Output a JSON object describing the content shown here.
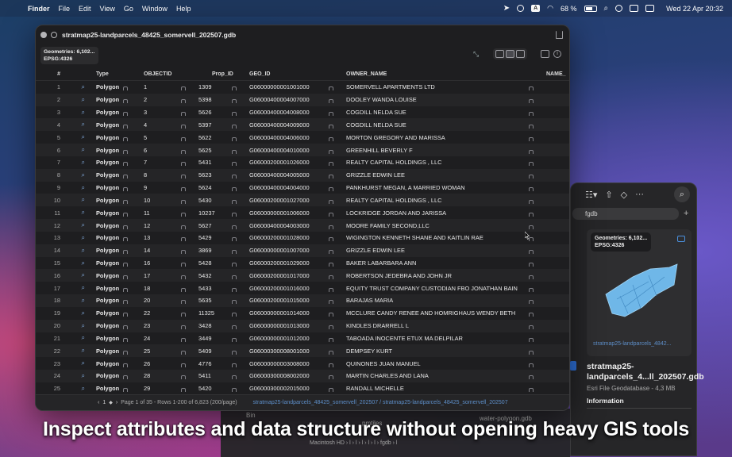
{
  "menubar": {
    "app": "Finder",
    "items": [
      "File",
      "Edit",
      "View",
      "Go",
      "Window",
      "Help"
    ],
    "battery": "68 %",
    "clock": "Wed 22 Apr  20:32",
    "icons": [
      "apple-icon",
      "telegram-icon",
      "shield-icon",
      "input-a-icon",
      "wifi-icon",
      "battery-icon",
      "search-icon",
      "user-circle-icon",
      "window-icon",
      "control-center-icon"
    ]
  },
  "window": {
    "title": "stratmap25-landparcels_48425_somervell_202507.gdb",
    "badge_line1": "Geometries: 6,102...",
    "badge_line2": "EPSG:4326"
  },
  "table": {
    "columns": [
      "#",
      "",
      "Type",
      "OBJECTID",
      "Prop_ID",
      "GEO_ID",
      "OWNER_NAME",
      "NAME_"
    ],
    "rows": [
      [
        "1",
        "Polygon",
        "1",
        "1309",
        "G06000000001001000",
        "SOMERVELL APARTMENTS LTD"
      ],
      [
        "2",
        "Polygon",
        "2",
        "5398",
        "G06000400004007000",
        "DOOLEY WANDA LOUISE"
      ],
      [
        "3",
        "Polygon",
        "3",
        "5626",
        "G06000400004008000",
        "COGDILL NELDA SUE"
      ],
      [
        "4",
        "Polygon",
        "4",
        "5397",
        "G06000400004009000",
        "COGDILL NELDA SUE"
      ],
      [
        "5",
        "Polygon",
        "5",
        "5622",
        "G06000400004006000",
        "MORTON GREGORY AND MARISSA"
      ],
      [
        "6",
        "Polygon",
        "6",
        "5625",
        "G06000400004010000",
        "GREENHILL BEVERLY F"
      ],
      [
        "7",
        "Polygon",
        "7",
        "5431",
        "G06000200001026000",
        "REALTY CAPITAL HOLDINGS , LLC"
      ],
      [
        "8",
        "Polygon",
        "8",
        "5623",
        "G06000400004005000",
        "GRIZZLE EDWIN LEE"
      ],
      [
        "9",
        "Polygon",
        "9",
        "5624",
        "G06000400004004000",
        "PANKHURST MEGAN, A MARRIED WOMAN"
      ],
      [
        "10",
        "Polygon",
        "10",
        "5430",
        "G06000200001027000",
        "REALTY CAPITAL HOLDINGS , LLC"
      ],
      [
        "11",
        "Polygon",
        "11",
        "10237",
        "G06000000001006000",
        "LOCKRIDGE JORDAN AND JARISSA"
      ],
      [
        "12",
        "Polygon",
        "12",
        "5627",
        "G06000400004003000",
        "MOORE FAMILY SECOND,LLC"
      ],
      [
        "13",
        "Polygon",
        "13",
        "5429",
        "G06000200001028000",
        "WIGINGTON KENNETH SHANE AND KAITLIN RAE"
      ],
      [
        "14",
        "Polygon",
        "14",
        "3869",
        "G06000000001007000",
        "GRIZZLE EDWIN LEE"
      ],
      [
        "15",
        "Polygon",
        "16",
        "5428",
        "G06000200001029000",
        "BAKER LABARBARA ANN"
      ],
      [
        "16",
        "Polygon",
        "17",
        "5432",
        "G06000200001017000",
        "ROBERTSON JEDEBRA AND JOHN JR"
      ],
      [
        "17",
        "Polygon",
        "18",
        "5433",
        "G06000200001016000",
        "EQUITY TRUST COMPANY CUSTODIAN FBO JONATHAN BAIN"
      ],
      [
        "18",
        "Polygon",
        "20",
        "5635",
        "G06000200001015000",
        "BARAJAS MARIA"
      ],
      [
        "19",
        "Polygon",
        "22",
        "11325",
        "G06000000001014000",
        "MCCLURE CANDY RENEE AND HOMRIGHAUS WENDY BETH"
      ],
      [
        "20",
        "Polygon",
        "23",
        "3428",
        "G06000000001013000",
        "KINDLES DRARRELL L"
      ],
      [
        "21",
        "Polygon",
        "24",
        "3449",
        "G06000000001012000",
        "TABOADA INOCENTE ETUX MA DELPILAR"
      ],
      [
        "22",
        "Polygon",
        "25",
        "5409",
        "G06000300008001000",
        "DEMPSEY KURT"
      ],
      [
        "23",
        "Polygon",
        "26",
        "4776",
        "G06000000003008000",
        "QUINONES JUAN MANUEL"
      ],
      [
        "24",
        "Polygon",
        "28",
        "5411",
        "G06000300008002000",
        "MARTIN CHARLES AND LANA"
      ],
      [
        "25",
        "Polygon",
        "29",
        "5420",
        "G06000300002015000",
        "RANDALL MICHELLE"
      ]
    ]
  },
  "statusbar": {
    "page_field": "1",
    "page_info": "Page 1 of 35 - Rows 1-200 of 6,823 (200/page)",
    "path": "stratmap25-landparcels_48425_somervell_202507 / stratmap25-landparcels_48425_somervell_202507"
  },
  "back_window": {
    "tab_label": "fgdb",
    "badge_line1": "Geometries: 6,102...",
    "badge_line2": "EPSG:4326",
    "preview_name": "stratmap25-landparcels_4842...",
    "title_line1": "stratmap25-",
    "title_line2": "landparcels_4...ll_202507.gdb",
    "subtitle": "Esri File Geodatabase - 4,3 MB",
    "section": "Information"
  },
  "finder_back": {
    "bin": "Bin",
    "pmtiles": "pmtiles",
    "water": "water-polygon.gdb",
    "path": "Macintosh HD  ›  l  ›  l  ›  l  ›  l  ›  l  ›  fgdb  ›  l"
  },
  "caption": "Inspect attributes and data structure without opening heavy GIS tools"
}
